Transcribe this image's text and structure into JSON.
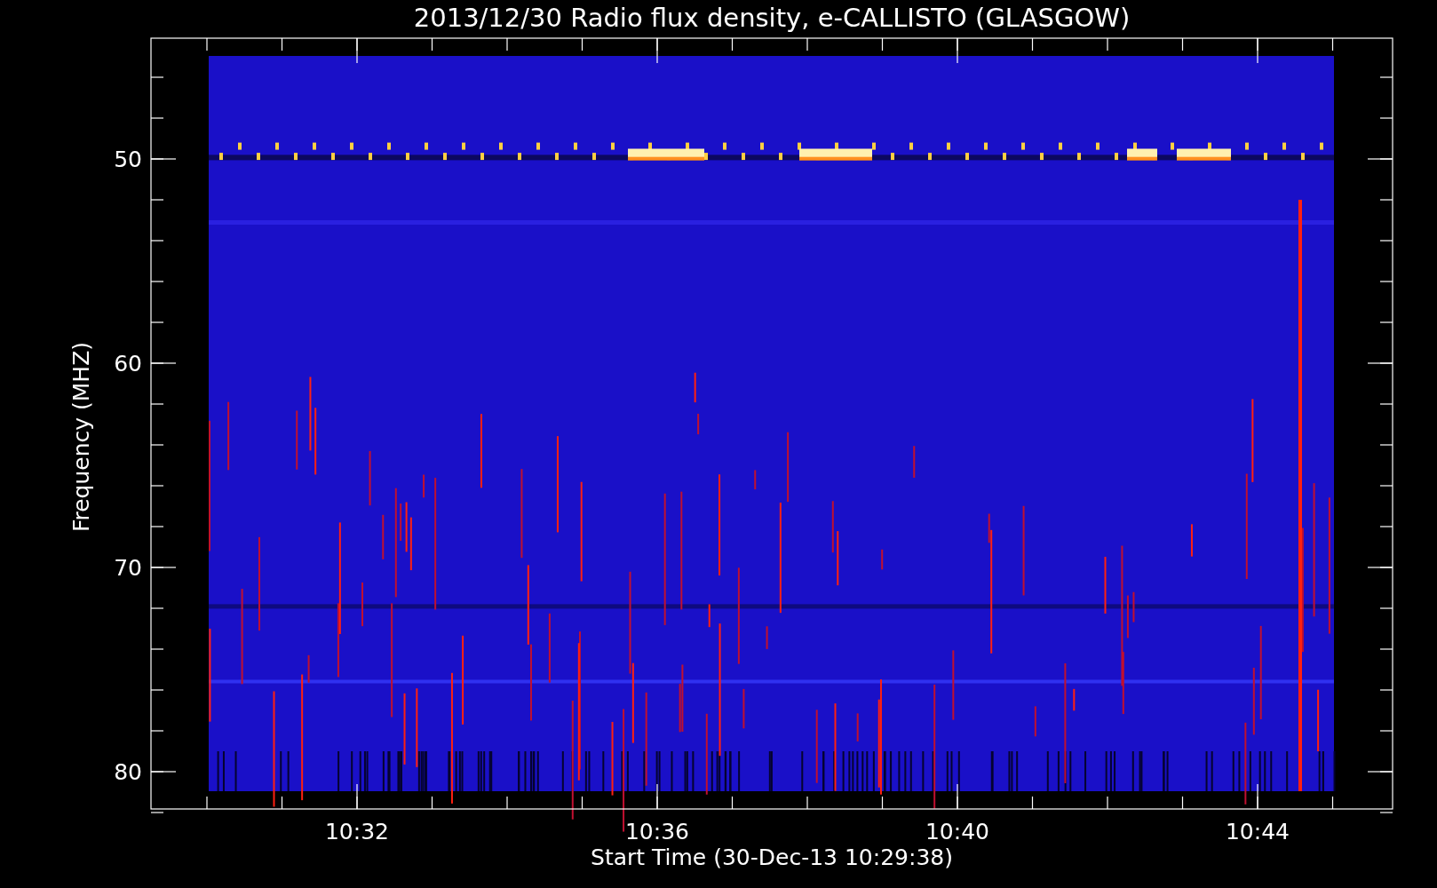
{
  "title": "2013/12/30  Radio flux density, e-CALLISTO (GLASGOW)",
  "y_axis": {
    "label": "Frequency (MHZ)",
    "ticks": [
      "50",
      "60",
      "70",
      "80"
    ]
  },
  "x_axis": {
    "label": "Start Time (30-Dec-13 10:29:38)",
    "ticks": [
      "10:32",
      "10:36",
      "10:40",
      "10:44"
    ]
  }
}
